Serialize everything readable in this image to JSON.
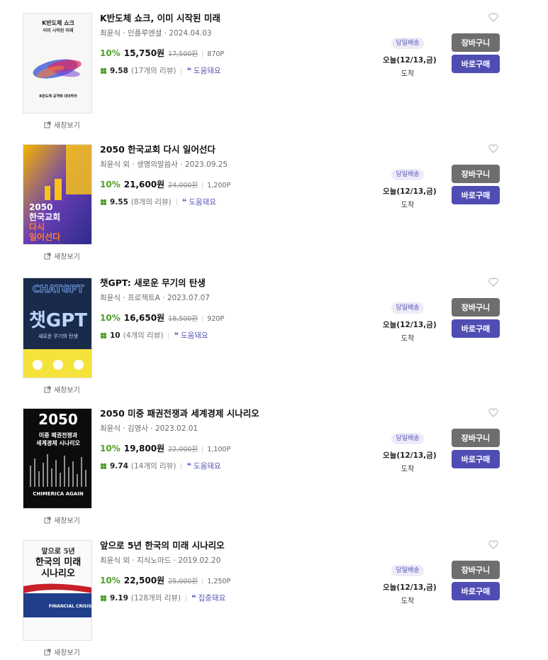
{
  "common": {
    "preview_label": "새창보기",
    "cart_label": "장바구니",
    "buy_label": "바로구매",
    "arrive_label": "도착",
    "quote_mark": "❝"
  },
  "books": [
    {
      "title": "K반도체 쇼크, 이미 시작된 미래",
      "meta": "최윤식 · 인플루엔셜 · 2024.04.03",
      "discount": "10%",
      "price": "15,750원",
      "original_price": "17,500원",
      "points": "870P",
      "rating": "9.58",
      "reviews": "(17개의 리뷰)",
      "review_tag": "도움돼요",
      "delivery_badge": "당일배송",
      "delivery_date": "오늘(12/13,금)",
      "cover": {
        "line1": "K반도체 쇼크",
        "line2": "이미 시작된 미래",
        "bottom": "K반도체 공격에 대비하라"
      }
    },
    {
      "title": "2050 한국교회 다시 일어선다",
      "meta": "최윤식 외 · 생명의말씀사 · 2023.09.25",
      "discount": "10%",
      "price": "21,600원",
      "original_price": "24,000원",
      "points": "1,200P",
      "rating": "9.55",
      "reviews": "(8개의 리뷰)",
      "review_tag": "도움돼요",
      "delivery_badge": "당일배송",
      "delivery_date": "오늘(12/13,금)",
      "cover": {
        "line1": "2050",
        "line2": "한국교회",
        "line3": "다시",
        "line4": "일어선다"
      }
    },
    {
      "title": "챗GPT: 새로운 무기의 탄생",
      "meta": "최윤식 · 프로젝트A · 2023.07.07",
      "discount": "10%",
      "price": "16,650원",
      "original_price": "18,500원",
      "points": "920P",
      "rating": "10",
      "reviews": "(4개의 리뷰)",
      "review_tag": "도움돼요",
      "delivery_badge": "당일배송",
      "delivery_date": "오늘(12/13,금)",
      "cover": {
        "line1": "CHATGPT",
        "line2": "챗GPT",
        "line3": "새로운 무기의 탄생"
      }
    },
    {
      "title": "2050 미중 패권전쟁과 세계경제 시나리오",
      "meta": "최윤식 · 김영사 · 2023.02.01",
      "discount": "10%",
      "price": "19,800원",
      "original_price": "22,000원",
      "points": "1,100P",
      "rating": "9.74",
      "reviews": "(14개의 리뷰)",
      "review_tag": "도움돼요",
      "delivery_badge": "당일배송",
      "delivery_date": "오늘(12/13,금)",
      "cover": {
        "line1": "2050",
        "line2": "미중 패권전쟁과",
        "line3": "세계경제 시나리오",
        "line4": "CHIMERICA AGAIN"
      }
    },
    {
      "title": "앞으로 5년 한국의 미래 시나리오",
      "meta": "최윤식 외 · 지식노마드 · 2019.02.20",
      "discount": "10%",
      "price": "22,500원",
      "original_price": "25,000원",
      "points": "1,250P",
      "rating": "9.19",
      "reviews": "(128개의 리뷰)",
      "review_tag": "집중돼요",
      "delivery_badge": "당일배송",
      "delivery_date": "오늘(12/13,금)",
      "cover": {
        "line1": "앞으로 5년",
        "line2": "한국의 미래",
        "line3": "시나리오",
        "line4": "FINANCIAL CRISIS"
      }
    }
  ]
}
